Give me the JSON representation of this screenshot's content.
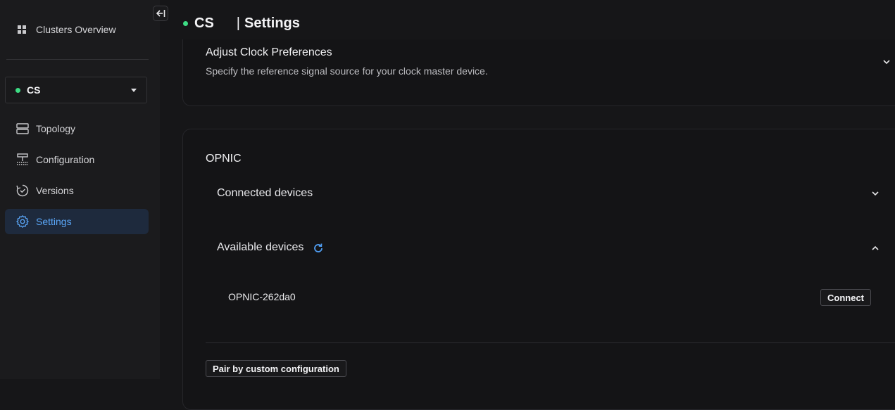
{
  "sidebar": {
    "overview_label": "Clusters Overview",
    "cluster": {
      "name": "CS",
      "status_color": "#3ddc84"
    },
    "items": [
      {
        "label": "Topology",
        "icon": "topology-icon"
      },
      {
        "label": "Configuration",
        "icon": "configuration-icon"
      },
      {
        "label": "Versions",
        "icon": "versions-icon"
      },
      {
        "label": "Settings",
        "icon": "gear-icon",
        "active": true
      }
    ]
  },
  "header": {
    "cluster_name": "CS",
    "separator": "|",
    "page_title": "Settings"
  },
  "clock": {
    "title": "Adjust Clock Preferences",
    "description": "Specify the reference signal source for your clock master device."
  },
  "opnic": {
    "title": "OPNIC",
    "connected_label": "Connected devices",
    "available_label": "Available devices",
    "devices": [
      {
        "name": "OPNIC-262da0",
        "action": "Connect"
      }
    ],
    "pair_button": "Pair by custom configuration"
  },
  "colors": {
    "accent": "#5aa6f7",
    "status_online": "#3ddc84",
    "background": "#161618"
  }
}
